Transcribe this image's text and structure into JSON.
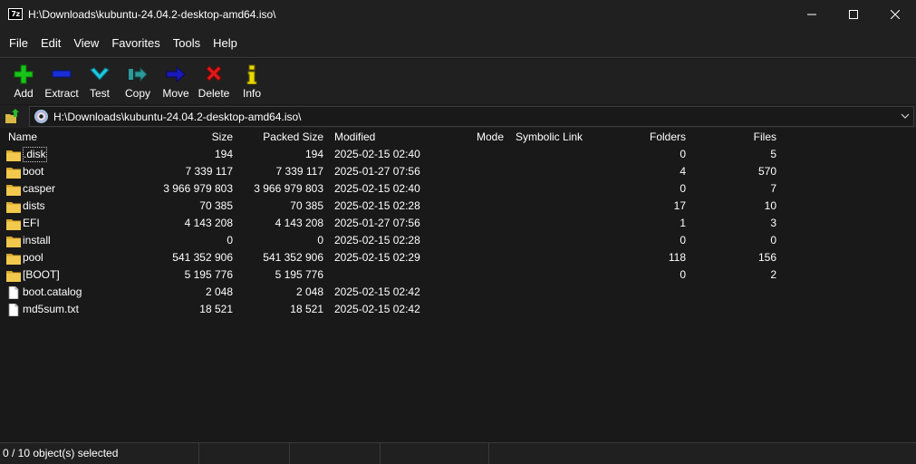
{
  "window": {
    "icon_text": "7z",
    "title": "H:\\Downloads\\kubuntu-24.04.2-desktop-amd64.iso\\"
  },
  "menu": [
    "File",
    "Edit",
    "View",
    "Favorites",
    "Tools",
    "Help"
  ],
  "toolbar": [
    {
      "label": "Add",
      "icon": "plus-icon",
      "color": "#18c418"
    },
    {
      "label": "Extract",
      "icon": "minus-icon",
      "color": "#1a2fd8"
    },
    {
      "label": "Test",
      "icon": "check-icon",
      "color": "#1ec8e0"
    },
    {
      "label": "Copy",
      "icon": "copy-arrow-icon",
      "color": "#2a9a9a"
    },
    {
      "label": "Move",
      "icon": "move-arrow-icon",
      "color": "#1a1ab8"
    },
    {
      "label": "Delete",
      "icon": "delete-x-icon",
      "color": "#e01818"
    },
    {
      "label": "Info",
      "icon": "info-icon",
      "color": "#e8d800"
    }
  ],
  "address": {
    "path": "H:\\Downloads\\kubuntu-24.04.2-desktop-amd64.iso\\"
  },
  "columns": {
    "name": "Name",
    "size": "Size",
    "packed": "Packed Size",
    "modified": "Modified",
    "mode": "Mode",
    "symlink": "Symbolic Link",
    "folders": "Folders",
    "files": "Files"
  },
  "rows": [
    {
      "type": "folder",
      "name": ".disk",
      "size": "194",
      "packed": "194",
      "modified": "2025-02-15 02:40",
      "folders": "0",
      "files": "5"
    },
    {
      "type": "folder",
      "name": "boot",
      "size": "7 339 117",
      "packed": "7 339 117",
      "modified": "2025-01-27 07:56",
      "folders": "4",
      "files": "570"
    },
    {
      "type": "folder",
      "name": "casper",
      "size": "3 966 979 803",
      "packed": "3 966 979 803",
      "modified": "2025-02-15 02:40",
      "folders": "0",
      "files": "7"
    },
    {
      "type": "folder",
      "name": "dists",
      "size": "70 385",
      "packed": "70 385",
      "modified": "2025-02-15 02:28",
      "folders": "17",
      "files": "10"
    },
    {
      "type": "folder",
      "name": "EFI",
      "size": "4 143 208",
      "packed": "4 143 208",
      "modified": "2025-01-27 07:56",
      "folders": "1",
      "files": "3"
    },
    {
      "type": "folder",
      "name": "install",
      "size": "0",
      "packed": "0",
      "modified": "2025-02-15 02:28",
      "folders": "0",
      "files": "0"
    },
    {
      "type": "folder",
      "name": "pool",
      "size": "541 352 906",
      "packed": "541 352 906",
      "modified": "2025-02-15 02:29",
      "folders": "118",
      "files": "156"
    },
    {
      "type": "folder",
      "name": "[BOOT]",
      "size": "5 195 776",
      "packed": "5 195 776",
      "modified": "",
      "folders": "0",
      "files": "2"
    },
    {
      "type": "file",
      "name": "boot.catalog",
      "size": "2 048",
      "packed": "2 048",
      "modified": "2025-02-15 02:42",
      "folders": "",
      "files": ""
    },
    {
      "type": "file",
      "name": "md5sum.txt",
      "size": "18 521",
      "packed": "18 521",
      "modified": "2025-02-15 02:42",
      "folders": "",
      "files": ""
    }
  ],
  "status": {
    "selection": "0 / 10 object(s) selected",
    "cell2": "",
    "cell3": "",
    "cell4": ""
  }
}
